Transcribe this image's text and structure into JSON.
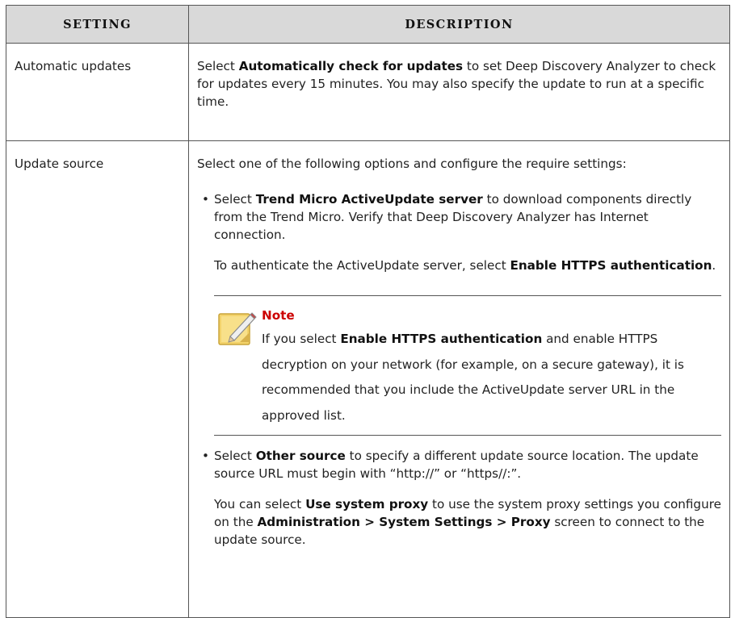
{
  "table": {
    "headers": [
      "Setting",
      "Description"
    ],
    "row1": {
      "setting": "Automatic updates",
      "desc": {
        "t1": "Select ",
        "b1": "Automatically check for updates",
        "t2": " to set Deep Discovery Analyzer to check for updates every 15 minutes. You may also specify the update to run at a specific time."
      }
    },
    "row2": {
      "setting": "Update source",
      "intro": "Select one of the following options and configure the require settings:",
      "bullet1": {
        "dot": "•",
        "t1": "Select ",
        "b1": "Trend Micro ActiveUpdate server",
        "t2": " to download components directly from the Trend Micro. Verify that Deep Discovery Analyzer has Internet connection."
      },
      "auth": {
        "t1": "To authenticate the ActiveUpdate server, select ",
        "b1": "Enable HTTPS authentication",
        "t2": "."
      },
      "note": {
        "title": "Note",
        "t1": "If you select ",
        "b1": "Enable HTTPS authentication",
        "t2": " and enable HTTPS decryption on your network (for example, on a secure gateway), it is recommended that you include the ActiveUpdate server URL in the approved list."
      },
      "bullet2": {
        "dot": "•",
        "t1": "Select ",
        "b1": "Other source",
        "t2": " to specify a different update source location. The update source URL must begin with “http://” or “https//:”."
      },
      "proxy": {
        "t1": "You can select ",
        "b1": "Use system proxy",
        "t2": " to use the system proxy settings you configure on the ",
        "b2": "Administration > System Settings > Proxy",
        "t3": " screen to connect to the update source."
      }
    }
  },
  "icons": {
    "note": "note-pencil-icon"
  },
  "colors": {
    "header_bg": "#d9d9d9",
    "note_title": "#cc0000",
    "note_icon": "#f3d36b"
  }
}
